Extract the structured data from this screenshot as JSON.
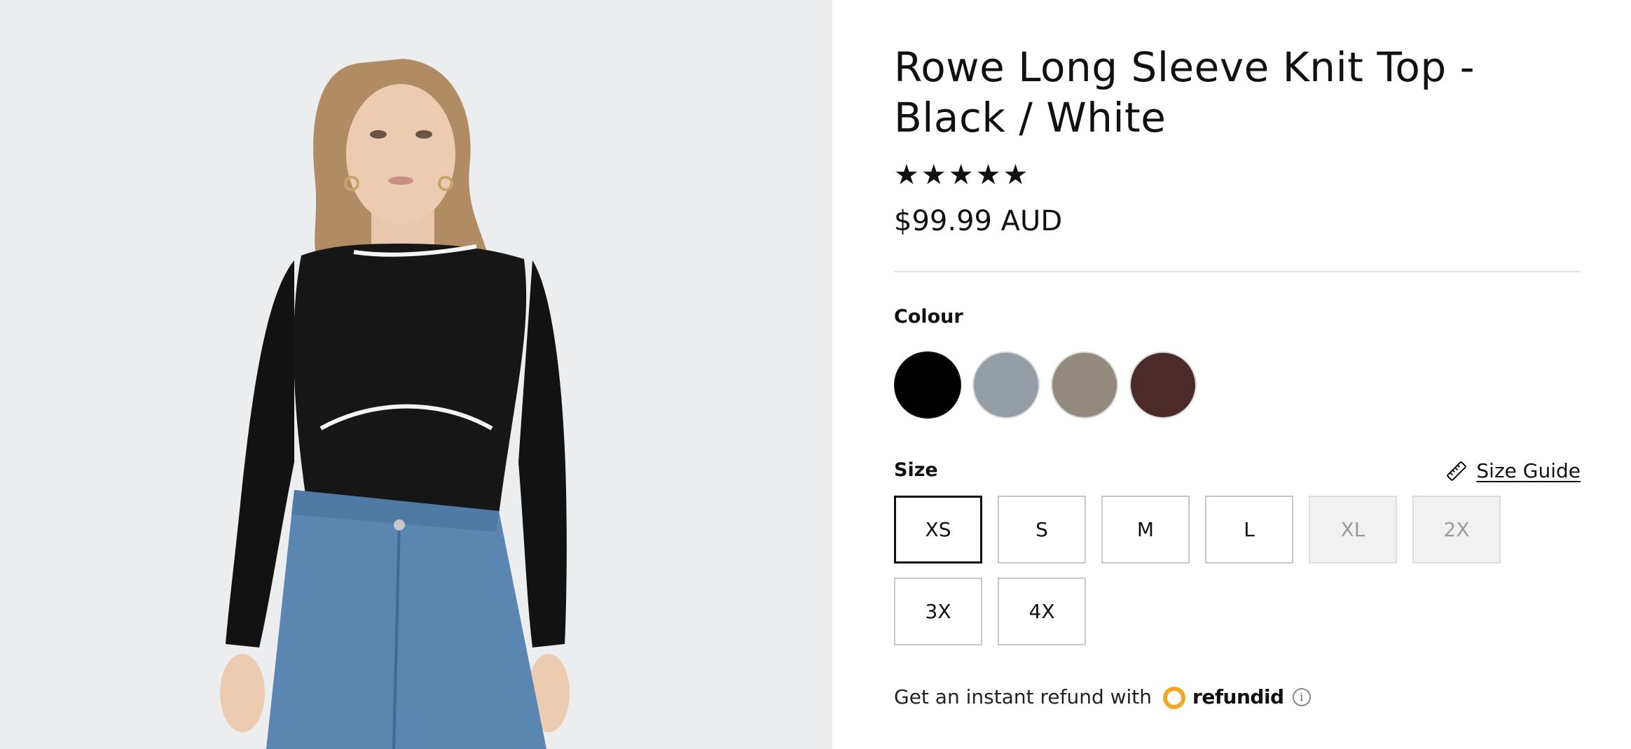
{
  "product": {
    "title": "Rowe Long Sleeve Knit Top - Black / White",
    "rating": 5,
    "rating_max": 5,
    "price": "$99.99 AUD"
  },
  "colour": {
    "label": "Colour",
    "swatches": [
      {
        "name": "black-swatch",
        "color": "#000000",
        "selected": true
      },
      {
        "name": "grey-swatch",
        "color": "#959ea6",
        "selected": false
      },
      {
        "name": "taupe-swatch",
        "color": "#94897d",
        "selected": false
      },
      {
        "name": "burgundy-swatch",
        "color": "#4a2b2a",
        "selected": false
      }
    ]
  },
  "size": {
    "label": "Size",
    "guide_label": "Size Guide",
    "guide_icon": "ruler-icon",
    "options": [
      {
        "label": "XS",
        "state": "selected"
      },
      {
        "label": "S",
        "state": "available"
      },
      {
        "label": "M",
        "state": "available"
      },
      {
        "label": "L",
        "state": "available"
      },
      {
        "label": "XL",
        "state": "unavailable"
      },
      {
        "label": "2X",
        "state": "unavailable"
      },
      {
        "label": "3X",
        "state": "available"
      },
      {
        "label": "4X",
        "state": "available"
      }
    ]
  },
  "refund": {
    "text": "Get an instant refund with",
    "brand": "refundid",
    "brand_icon": "refundid-logo-icon",
    "info_icon": "info-icon",
    "brand_color": "#f5a623"
  },
  "image": {
    "icon": "product-photo",
    "background": "#ebedef"
  }
}
